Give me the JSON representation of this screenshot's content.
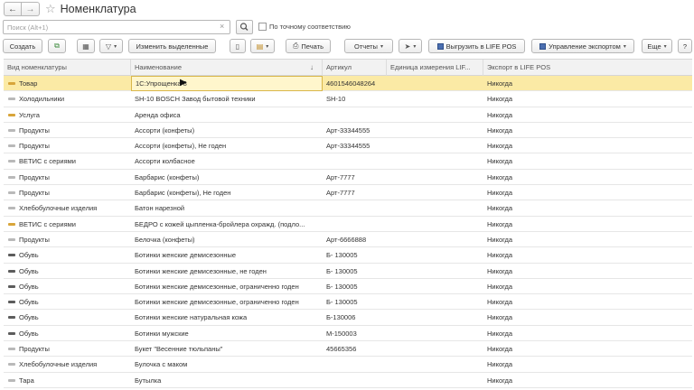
{
  "header": {
    "back_icon": "arrow-left-icon",
    "forward_icon": "arrow-right-icon",
    "favorite_icon": "star-icon",
    "title": "Номенклатура"
  },
  "search": {
    "placeholder": "Поиск (Alt+1)",
    "value": "",
    "exact_match_label": "По точному соответствию",
    "exact_match_checked": false
  },
  "toolbar": {
    "create_label": "Создать",
    "edit_selected_label": "Изменить выделенные",
    "print_label": "Печать",
    "reports_label": "Отчеты",
    "upload_lifepos_label": "Выгрузить в LIFE POS",
    "export_control_label": "Управление экспортом",
    "more_label": "Еще",
    "help_label": "?"
  },
  "table": {
    "columns": [
      "Вид номенклатуры",
      "Наименование",
      "Артикул",
      "Единица измерения LIF...",
      "Экспорт в LIFE POS"
    ],
    "sort_indicator": "↓",
    "rows": [
      {
        "kind": "Товар",
        "name": "1С:Упрощенка 8",
        "article": "4601546048264",
        "unit": "",
        "export": "Никогда",
        "icon": "warn",
        "selected": true
      },
      {
        "kind": "Холодильники",
        "name": "SH-10 BOSCH Завод бытовой техники",
        "article": "SH-10",
        "unit": "",
        "export": "Никогда",
        "icon": "normal"
      },
      {
        "kind": "Услуга",
        "name": "Аренда офиса",
        "article": "",
        "unit": "",
        "export": "Никогда",
        "icon": "warn"
      },
      {
        "kind": "Продукты",
        "name": "Ассорти (конфеты)",
        "article": "Арт-33344555",
        "unit": "",
        "export": "Никогда",
        "icon": "normal"
      },
      {
        "kind": "Продукты",
        "name": "Ассорти (конфеты), Не годен",
        "article": "Арт-33344555",
        "unit": "",
        "export": "Никогда",
        "icon": "normal"
      },
      {
        "kind": "ВЕТИС с сериями",
        "name": "Ассорти колбасное",
        "article": "",
        "unit": "",
        "export": "Никогда",
        "icon": "normal"
      },
      {
        "kind": "Продукты",
        "name": "Барбарис (конфеты)",
        "article": "Арт-7777",
        "unit": "",
        "export": "Никогда",
        "icon": "normal"
      },
      {
        "kind": "Продукты",
        "name": "Барбарис (конфеты), Не годен",
        "article": "Арт-7777",
        "unit": "",
        "export": "Никогда",
        "icon": "normal"
      },
      {
        "kind": "Хлебобулочные изделия",
        "name": "Батон нарезной",
        "article": "",
        "unit": "",
        "export": "Никогда",
        "icon": "normal"
      },
      {
        "kind": "ВЕТИС с сериями",
        "name": "БЕДРО с кожей цыпленка-бройлера охражд. (подло...",
        "article": "",
        "unit": "",
        "export": "Никогда",
        "icon": "warn"
      },
      {
        "kind": "Продукты",
        "name": "Белочка (конфеты)",
        "article": "Арт-6666888",
        "unit": "",
        "export": "Никогда",
        "icon": "normal"
      },
      {
        "kind": "Обувь",
        "name": "Ботинки женские демисезонные",
        "article": "Б- 130005",
        "unit": "",
        "export": "Никогда",
        "icon": "dark"
      },
      {
        "kind": "Обувь",
        "name": "Ботинки женские демисезонные, не годен",
        "article": "Б- 130005",
        "unit": "",
        "export": "Никогда",
        "icon": "dark"
      },
      {
        "kind": "Обувь",
        "name": "Ботинки женские демисезонные, ограниченно годен",
        "article": "Б- 130005",
        "unit": "",
        "export": "Никогда",
        "icon": "dark"
      },
      {
        "kind": "Обувь",
        "name": "Ботинки женские демисезонные, ограниченно годен",
        "article": "Б- 130005",
        "unit": "",
        "export": "Никогда",
        "icon": "dark"
      },
      {
        "kind": "Обувь",
        "name": "Ботинки женские натуральная кожа",
        "article": "Б-130006",
        "unit": "",
        "export": "Никогда",
        "icon": "dark"
      },
      {
        "kind": "Обувь",
        "name": "Ботинки мужские",
        "article": "М-150003",
        "unit": "",
        "export": "Никогда",
        "icon": "dark"
      },
      {
        "kind": "Продукты",
        "name": "Букет \"Весенние тюльпаны\"",
        "article": "45665356",
        "unit": "",
        "export": "Никогда",
        "icon": "normal"
      },
      {
        "kind": "Хлебобулочные изделия",
        "name": "Булочка с маком",
        "article": "",
        "unit": "",
        "export": "Никогда",
        "icon": "normal"
      },
      {
        "kind": "Тара",
        "name": "Бутылка",
        "article": "",
        "unit": "",
        "export": "Никогда",
        "icon": "normal"
      }
    ]
  },
  "colors": {
    "selected_row": "#fbeaa5",
    "toolbar_accent": "#4a6eb0"
  }
}
